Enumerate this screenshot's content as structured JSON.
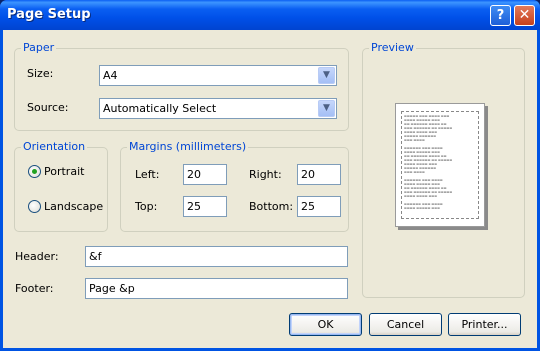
{
  "window": {
    "title": "Page Setup"
  },
  "paper": {
    "legend": "Paper",
    "size_label": "Size:",
    "size_value": "A4",
    "source_label": "Source:",
    "source_value": "Automatically Select"
  },
  "orientation": {
    "legend": "Orientation",
    "portrait_label": "Portrait",
    "landscape_label": "Landscape",
    "selected": "Portrait"
  },
  "margins": {
    "legend": "Margins (millimeters)",
    "left_label": "Left:",
    "left_value": "20",
    "right_label": "Right:",
    "right_value": "20",
    "top_label": "Top:",
    "top_value": "25",
    "bottom_label": "Bottom:",
    "bottom_value": "25"
  },
  "header": {
    "label": "Header:",
    "value": "&f"
  },
  "footer": {
    "label": "Footer:",
    "value": "Page &p"
  },
  "preview": {
    "legend": "Preview"
  },
  "buttons": {
    "ok": "OK",
    "cancel": "Cancel",
    "printer": "Printer..."
  },
  "colors": {
    "titlebar": "#0054e3",
    "face": "#ece9d8",
    "legend_text": "#0046d5",
    "radio_dot": "#21a121"
  },
  "icons": {
    "help": "question-mark",
    "close": "x-close",
    "dropdown": "chevron-down"
  }
}
